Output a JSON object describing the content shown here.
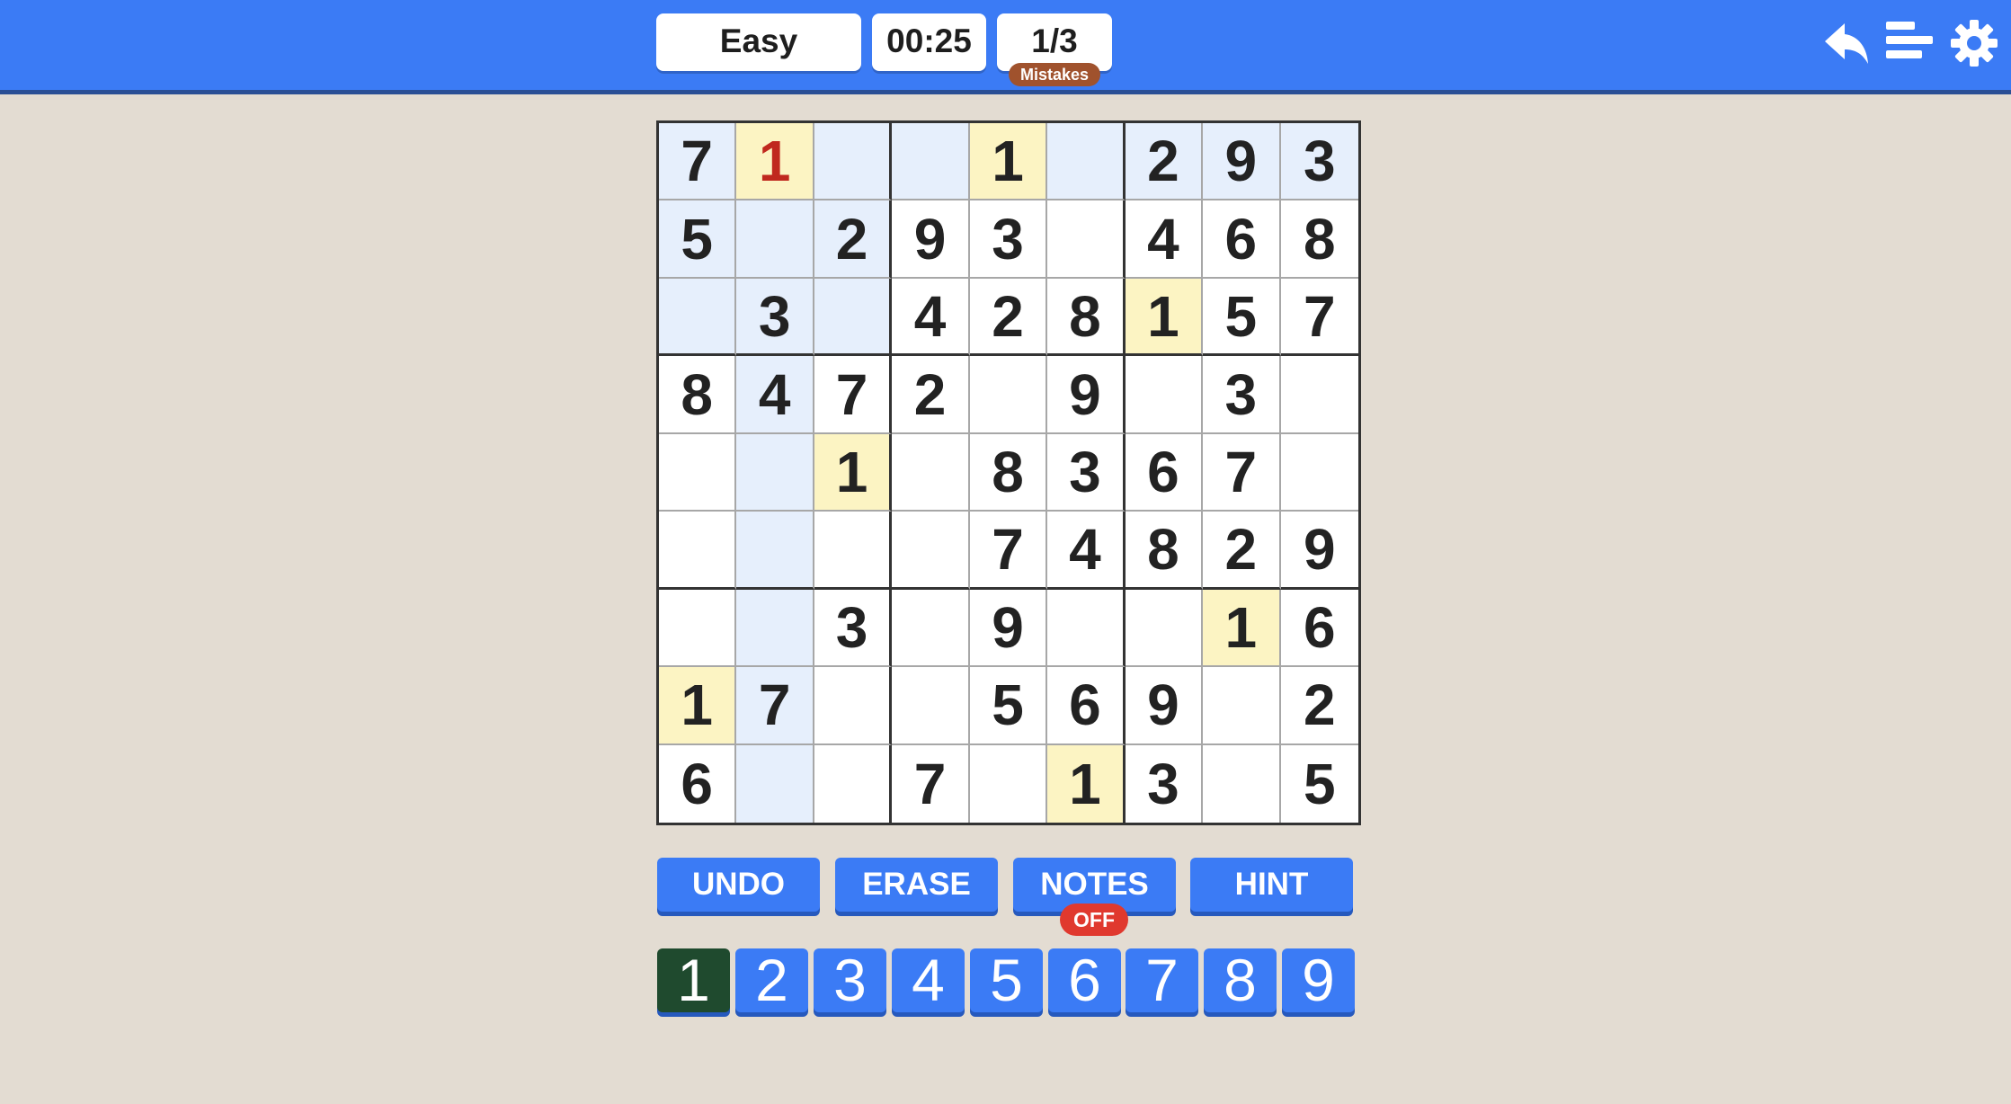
{
  "header": {
    "difficulty": "Easy",
    "timer": "00:25",
    "mistakes": "1/3",
    "mistakes_label": "Mistakes"
  },
  "icons": {
    "undo": "undo-arrow-icon",
    "stats": "stats-bars-icon",
    "settings": "gear-icon"
  },
  "board": {
    "cells": [
      [
        "7",
        "1",
        "",
        "",
        "1",
        "",
        "2",
        "9",
        "3"
      ],
      [
        "5",
        "",
        "2",
        "9",
        "3",
        "",
        "4",
        "6",
        "8"
      ],
      [
        "",
        "3",
        "",
        "4",
        "2",
        "8",
        "1",
        "5",
        "7"
      ],
      [
        "8",
        "4",
        "7",
        "2",
        "",
        "9",
        "",
        "3",
        ""
      ],
      [
        "",
        "",
        "1",
        "",
        "8",
        "3",
        "6",
        "7",
        ""
      ],
      [
        "",
        "",
        "",
        "",
        "7",
        "4",
        "8",
        "2",
        "9"
      ],
      [
        "",
        "",
        "3",
        "",
        "9",
        "",
        "",
        "1",
        "6"
      ],
      [
        "1",
        "7",
        "",
        "",
        "5",
        "6",
        "9",
        "",
        "2"
      ],
      [
        "6",
        "",
        "",
        "7",
        "",
        "1",
        "3",
        "",
        "5"
      ]
    ],
    "selected": {
      "row": 0,
      "col": 1
    },
    "highlight_digit": "1",
    "error_cells": [
      [
        0,
        1
      ]
    ]
  },
  "controls": {
    "undo_label": "UNDO",
    "erase_label": "ERASE",
    "notes_label": "NOTES",
    "notes_state": "OFF",
    "hint_label": "HINT"
  },
  "numpad": {
    "digits": [
      "1",
      "2",
      "3",
      "4",
      "5",
      "6",
      "7",
      "8",
      "9"
    ],
    "active": "1"
  },
  "colors": {
    "primary": "#3b7bf5",
    "background": "#e3dcd2",
    "highlight": "#e6effc",
    "same_digit": "#fcf4c3",
    "error_text": "#c0281e",
    "mistakes_badge": "#a0522d",
    "notes_badge": "#e0392e",
    "numpad_active": "#1f4a2e"
  }
}
